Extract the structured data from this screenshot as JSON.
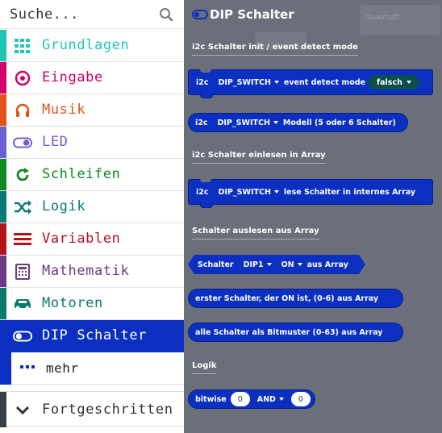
{
  "search": {
    "placeholder": "Suche..."
  },
  "categories": [
    {
      "label": "Grundlagen",
      "color": "#1ec7b5",
      "icon": "grid-icon"
    },
    {
      "label": "Eingabe",
      "color": "#d4006c",
      "icon": "target-icon"
    },
    {
      "label": "Musik",
      "color": "#e0521a",
      "icon": "headphones-icon"
    },
    {
      "label": "LED",
      "color": "#6c5ed6",
      "icon": "toggle-icon"
    },
    {
      "label": "Schleifen",
      "color": "#0e8a1e",
      "icon": "refresh-icon"
    },
    {
      "label": "Logik",
      "color": "#0a7a78",
      "icon": "shuffle-icon"
    },
    {
      "label": "Variablen",
      "color": "#b3131b",
      "icon": "lines-icon"
    },
    {
      "label": "Mathematik",
      "color": "#6d3a86",
      "icon": "calculator-icon"
    },
    {
      "label": "Motoren",
      "color": "#0a7a6c",
      "icon": "car-icon"
    },
    {
      "label": "DIP Schalter",
      "color": "#0b2fc0",
      "icon": "toggle-icon"
    }
  ],
  "more": {
    "label": "mehr",
    "icon": "ellipsis-icon"
  },
  "advanced": {
    "label": "Fortgeschritten",
    "icon": "chevron-down-icon"
  },
  "flyout": {
    "title": "DIP Schalter",
    "sections": {
      "init": "i2c Schalter init / event detect mode",
      "read": "i2c Schalter einlesen in Array",
      "array": "Schalter auslesen aus Array",
      "logic": "Logik"
    },
    "blocks": {
      "b1": {
        "prefix": "i2c",
        "dd": "DIP_SWITCH",
        "mid": "event detect mode",
        "bool": "falsch"
      },
      "b2": {
        "prefix": "i2c",
        "dd": "DIP_SWITCH",
        "mid": "Modell (5 oder 6 Schalter)"
      },
      "b3": {
        "prefix": "i2c",
        "dd": "DIP_SWITCH",
        "mid": "lese Schalter in internes Array"
      },
      "b4": {
        "prefix": "Schalter",
        "dd1": "DIP1",
        "dd2": "ON",
        "suffix": "aus Array"
      },
      "b5": {
        "text": "erster Schalter, der ON ist, (0-6) aus Array"
      },
      "b6": {
        "text": "alle Schalter als Bitmuster (0-63) aus Array"
      },
      "b7": {
        "prefix": "bitwise",
        "n1": "0",
        "op": "AND",
        "n2": "0"
      }
    },
    "background_labels": {
      "ghost": "dauerhaft"
    }
  },
  "colors": {
    "flyout_bg": "#6b6f7a",
    "block": "#0b2fc0",
    "active": "#0b2fc0"
  }
}
